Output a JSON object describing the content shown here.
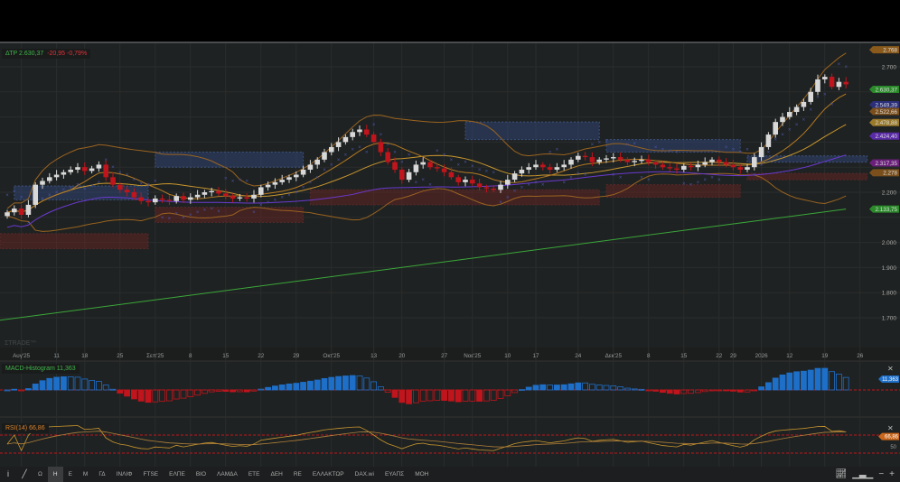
{
  "header": {
    "symbol": "ΔΤΡ",
    "price": "2.630,37",
    "change": "-20,95",
    "change_pct": "-0,79%"
  },
  "watermark": "ΣTRADE™",
  "macd": {
    "label": "MACD-Histogram",
    "value": "11,363"
  },
  "rsi": {
    "label": "RSI(14)",
    "value": "66,86",
    "level_label": "50"
  },
  "price_axis": {
    "ticks": [
      {
        "p": 2700,
        "t": "2.700"
      },
      {
        "p": 2200,
        "t": "2.200"
      },
      {
        "p": 2000,
        "t": "2.000"
      },
      {
        "p": 1900,
        "t": "1.900"
      },
      {
        "p": 1800,
        "t": "1.800"
      },
      {
        "p": 1700,
        "t": "1.700"
      }
    ]
  },
  "badges": [
    {
      "p": 2768,
      "t": "2.768",
      "color": "#8a5a1c"
    },
    {
      "p": 2610,
      "t": "2.630,37",
      "color": "#2a8a2a"
    },
    {
      "p": 2549,
      "t": "2.549,39",
      "color": "#2b2f7a"
    },
    {
      "p": 2522,
      "t": "2.522,66",
      "color": "#7a4f1c"
    },
    {
      "p": 2478,
      "t": "2.478,88",
      "color": "#9a7a2a"
    },
    {
      "p": 2424,
      "t": "2.424,40",
      "color": "#5a2aa8"
    },
    {
      "p": 2317,
      "t": "2.317,35",
      "color": "#6a1f7a"
    },
    {
      "p": 2278,
      "t": "2.278",
      "color": "#7a4f1c"
    },
    {
      "p": 2133,
      "t": "2.133,75",
      "color": "#2a8a2a"
    }
  ],
  "colors": {
    "up": "#d8d8d8",
    "down": "#c0151c",
    "bb": "#9a6420",
    "ma_fast": "#c8962e",
    "ma_slow": "#6a3ad0",
    "ma200": "#3aa83a",
    "sar": "#4a55a8",
    "macd_pos": "#1e6fc8",
    "macd_neg": "#c0151c",
    "rsi": "#c8962e",
    "bg": "#1f2222",
    "grid": "#2a2d2d"
  },
  "chart_data": {
    "type": "candlestick",
    "closes": [
      2120,
      2135,
      2110,
      2150,
      2230,
      2245,
      2260,
      2270,
      2280,
      2290,
      2300,
      2285,
      2295,
      2310,
      2260,
      2230,
      2210,
      2200,
      2180,
      2165,
      2160,
      2175,
      2170,
      2165,
      2185,
      2170,
      2180,
      2190,
      2200,
      2205,
      2195,
      2185,
      2175,
      2180,
      2175,
      2190,
      2220,
      2230,
      2240,
      2250,
      2260,
      2270,
      2290,
      2310,
      2330,
      2360,
      2380,
      2400,
      2420,
      2440,
      2450,
      2430,
      2400,
      2360,
      2320,
      2290,
      2250,
      2280,
      2310,
      2320,
      2300,
      2295,
      2280,
      2260,
      2240,
      2250,
      2235,
      2220,
      2215,
      2210,
      2230,
      2250,
      2275,
      2290,
      2300,
      2310,
      2300,
      2290,
      2300,
      2310,
      2330,
      2345,
      2340,
      2320,
      2330,
      2335,
      2340,
      2330,
      2320,
      2325,
      2330,
      2320,
      2310,
      2300,
      2295,
      2290,
      2305,
      2300,
      2310,
      2320,
      2330,
      2320,
      2310,
      2300,
      2290,
      2300,
      2340,
      2380,
      2430,
      2480,
      2500,
      2520,
      2540,
      2560,
      2600,
      2650,
      2660,
      2620,
      2640,
      2630
    ],
    "first_open": 2105,
    "ma200": {
      "start": 1690,
      "end": 2133
    },
    "ylim": [
      1650,
      2800
    ],
    "x_labels": [
      {
        "i": 2,
        "t": "Αυγ'25"
      },
      {
        "i": 7,
        "t": "11"
      },
      {
        "i": 11,
        "t": "18"
      },
      {
        "i": 16,
        "t": "25"
      },
      {
        "i": 21,
        "t": "Σεπ'25"
      },
      {
        "i": 26,
        "t": "8"
      },
      {
        "i": 31,
        "t": "15"
      },
      {
        "i": 36,
        "t": "22"
      },
      {
        "i": 41,
        "t": "29"
      },
      {
        "i": 46,
        "t": "Οκτ'25"
      },
      {
        "i": 52,
        "t": "13"
      },
      {
        "i": 56,
        "t": "20"
      },
      {
        "i": 62,
        "t": "27"
      },
      {
        "i": 66,
        "t": "Νοε'25"
      },
      {
        "i": 71,
        "t": "10"
      },
      {
        "i": 75,
        "t": "17"
      },
      {
        "i": 81,
        "t": "24"
      },
      {
        "i": 86,
        "t": "Δεκ'25"
      },
      {
        "i": 91,
        "t": "8"
      },
      {
        "i": 96,
        "t": "15"
      },
      {
        "i": 101,
        "t": "22"
      },
      {
        "i": 103,
        "t": "29"
      },
      {
        "i": 107,
        "t": "2026"
      },
      {
        "i": 111,
        "t": "12"
      },
      {
        "i": 116,
        "t": "19"
      },
      {
        "i": 121,
        "t": "26"
      }
    ],
    "zones": [
      {
        "kind": "supply",
        "i0": 1,
        "i1": 20,
        "p0": 2170,
        "p1": 2225
      },
      {
        "kind": "supply",
        "i0": 21,
        "i1": 42,
        "p0": 2300,
        "p1": 2360
      },
      {
        "kind": "supply",
        "i0": 65,
        "i1": 84,
        "p0": 2410,
        "p1": 2480
      },
      {
        "kind": "supply",
        "i0": 85,
        "i1": 104,
        "p0": 2360,
        "p1": 2410
      },
      {
        "kind": "supply",
        "i0": 105,
        "i1": 122,
        "p0": 2320,
        "p1": 2345
      },
      {
        "kind": "demand",
        "i0": -1,
        "i1": 20,
        "p0": 1975,
        "p1": 2035
      },
      {
        "kind": "demand",
        "i0": 21,
        "i1": 42,
        "p0": 2080,
        "p1": 2140
      },
      {
        "kind": "demand",
        "i0": 43,
        "i1": 84,
        "p0": 2150,
        "p1": 2210
      },
      {
        "kind": "demand",
        "i0": 85,
        "i1": 104,
        "p0": 2180,
        "p1": 2230
      },
      {
        "kind": "demand",
        "i0": 105,
        "i1": 122,
        "p0": 2250,
        "p1": 2275
      }
    ]
  },
  "toolbar": {
    "items": [
      "Ω",
      "Η",
      "Ε",
      "Μ",
      "ΓΔ",
      "ΙΝΛΙΦ",
      "FTSE",
      "ΕΛΠΕ",
      "ΒΙΟ",
      "ΛΑΜΔΑ",
      "ΕΤΕ",
      "ΔΕΗ",
      "RE",
      "ΕΛΛΑΚΤΩΡ",
      "DAX.wi",
      "ΕΥΑΠΣ",
      "ΜΟΗ"
    ],
    "active": "Η",
    "info": "i",
    "plus": "+",
    "minus": "−"
  }
}
